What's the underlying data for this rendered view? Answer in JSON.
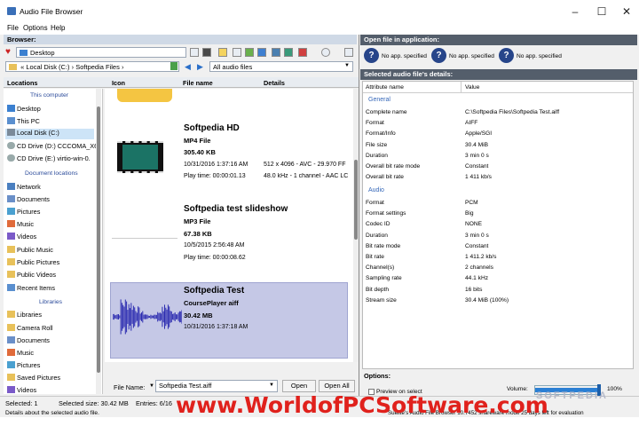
{
  "window": {
    "title": "Audio File Browser",
    "minimize": "–",
    "maximize": "☐",
    "close": "✕"
  },
  "menu": [
    "File",
    "Options",
    "Help"
  ],
  "browser": {
    "label": "Browser:",
    "location": "Desktop",
    "path": [
      "«",
      "Local Disk (C:)",
      "›",
      "Softpedia Files",
      "›"
    ],
    "filter": "All audio files"
  },
  "columns": {
    "locations": "Locations",
    "icon": "Icon",
    "file_name": "File name",
    "details": "Details"
  },
  "sidebar": {
    "this_pc_section": "This computer",
    "this_pc": [
      "Desktop",
      "This PC",
      "Local Disk (C:)",
      "CD Drive (D:) CCCOMA_X6",
      "CD Drive (E:) virtio-win-0."
    ],
    "doc_section": "Document locations",
    "docs": [
      "Network",
      "Documents",
      "Pictures",
      "Music",
      "Videos",
      "Public Music",
      "Public Pictures",
      "Public Videos",
      "Recent Items"
    ],
    "lib_section": "Libraries",
    "libs": [
      "Libraries",
      "Camera Roll",
      "Documents",
      "Music",
      "Pictures",
      "Saved Pictures",
      "Videos"
    ]
  },
  "files": [
    {
      "name": "Softpedia HD",
      "type": "MP4 File",
      "size": "305.40 KB",
      "date": "10/31/2016 1:37:16 AM",
      "play": "Play time: 00:00:01.13",
      "detail1": "512 x 4096 - AVC - 29.970 FF",
      "detail2": "48.0 kHz - 1 channel - AAC LC"
    },
    {
      "name": "Softpedia test slideshow",
      "type": "MP3 File",
      "size": "67.38 KB",
      "date": "10/5/2015 2:56:48 AM",
      "play": "Play time: 00:00:08.62"
    },
    {
      "name": "Softpedia Test",
      "type": "CoursePlayer aiff",
      "size": "30.42 MB",
      "date": "10/31/2016 1:37:18 AM"
    }
  ],
  "filename_bar": {
    "label": "File Name:",
    "value": "Softpedia Test.aiff",
    "open": "Open",
    "open_all": "Open All"
  },
  "open_in_app": {
    "label": "Open file in application:",
    "apps": [
      "No app. specified",
      "No app. specified",
      "No app. specified"
    ]
  },
  "details": {
    "label": "Selected audio file's details:",
    "col_name": "Attribute name",
    "col_value": "Value",
    "general_title": "General",
    "general": [
      [
        "Complete name",
        "C:\\Softpedia Files\\Softpedia Test.aiff"
      ],
      [
        "Format",
        "AIFF"
      ],
      [
        "Format/Info",
        "Apple/SGI"
      ],
      [
        "File size",
        "30.4 MiB"
      ],
      [
        "Duration",
        "3 min 0 s"
      ],
      [
        "Overall bit rate mode",
        "Constant"
      ],
      [
        "Overall bit rate",
        "1 411 kb/s"
      ]
    ],
    "audio_title": "Audio",
    "audio": [
      [
        "Format",
        "PCM"
      ],
      [
        "Format settings",
        "Big"
      ],
      [
        "Codec ID",
        "NONE"
      ],
      [
        "Duration",
        "3 min 0 s"
      ],
      [
        "Bit rate mode",
        "Constant"
      ],
      [
        "Bit rate",
        "1 411.2 kb/s"
      ],
      [
        "Channel(s)",
        "2 channels"
      ],
      [
        "Sampling rate",
        "44.1 kHz"
      ],
      [
        "Bit depth",
        "16 bits"
      ],
      [
        "Stream size",
        "30.4 MiB (100%)"
      ]
    ]
  },
  "options": {
    "label": "Options:",
    "preview": "Preview on select",
    "volume_label": "Volume:",
    "volume_value": "100%",
    "volume_level": 1.0
  },
  "status": {
    "selected": "Selected: 1",
    "selected_size": "Selected size: 30.42 MB",
    "entries": "Entries: 6/16",
    "info": "Details about the selected audio file.",
    "shareware": "Suelite's Audio File Browser 10.7452 shareware mode 25 days left for evaluation"
  },
  "watermark": "www.WorldofPCSoftware.com",
  "softpedia_mark": "SOFTPEDIA"
}
